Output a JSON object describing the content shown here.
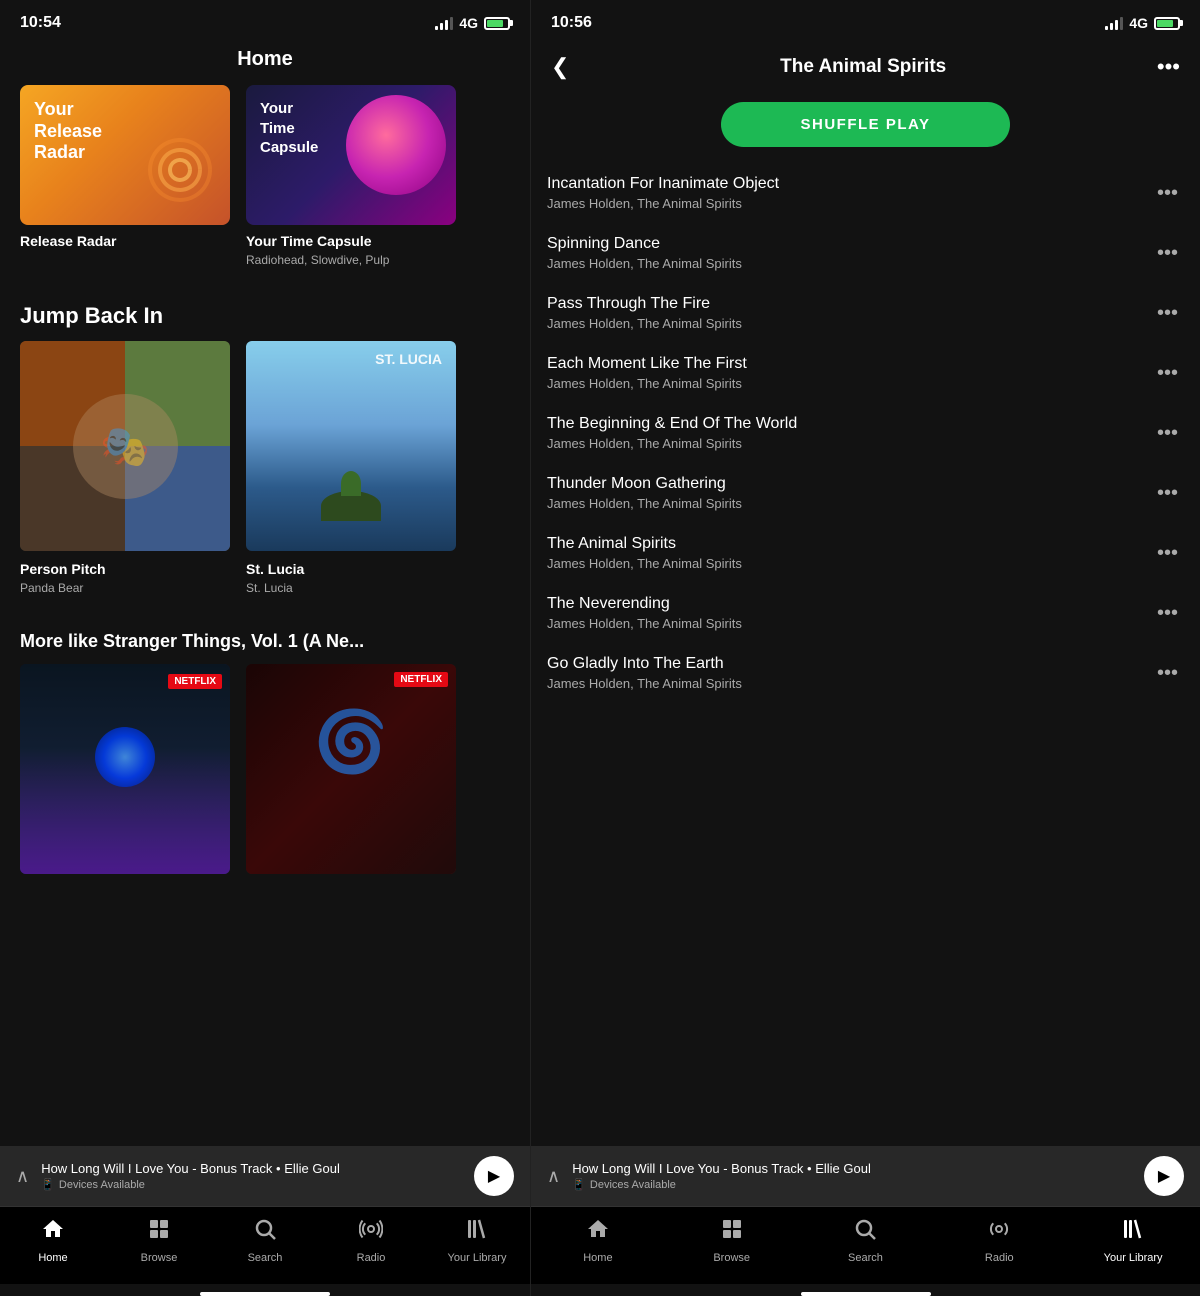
{
  "left": {
    "status": {
      "time": "10:54",
      "signal": "4G",
      "battery": "charging"
    },
    "title": "Home",
    "top_cards": [
      {
        "id": "release-radar",
        "title": "Release Radar",
        "subtitle": ""
      },
      {
        "id": "your-time-capsule",
        "title": "Your Time Capsule",
        "subtitle": "Radiohead, Slowdive, Pulp"
      }
    ],
    "jump_back_title": "Jump Back In",
    "jump_back_albums": [
      {
        "id": "person-pitch",
        "title": "Person Pitch",
        "artist": "Panda Bear"
      },
      {
        "id": "st-lucia",
        "title": "St. Lucia",
        "artist": "St. Lucia"
      }
    ],
    "more_like_title": "More like Stranger Things, Vol. 1 (A Ne...",
    "mini_player": {
      "track": "How Long Will I Love You - Bonus Track • Ellie Goul",
      "device": "Devices Available"
    },
    "nav": {
      "items": [
        {
          "id": "home",
          "label": "Home",
          "icon": "home",
          "active": true
        },
        {
          "id": "browse",
          "label": "Browse",
          "icon": "browse",
          "active": false
        },
        {
          "id": "search",
          "label": "Search",
          "icon": "search",
          "active": false
        },
        {
          "id": "radio",
          "label": "Radio",
          "icon": "radio",
          "active": false
        },
        {
          "id": "library",
          "label": "Your Library",
          "icon": "library",
          "active": false
        }
      ]
    }
  },
  "right": {
    "status": {
      "time": "10:56",
      "signal": "4G",
      "battery": "charging"
    },
    "title": "The Animal Spirits",
    "shuffle_label": "SHUFFLE PLAY",
    "tracks": [
      {
        "name": "Incantation For Inanimate Object",
        "artist": "James Holden, The Animal Spirits"
      },
      {
        "name": "Spinning Dance",
        "artist": "James Holden, The Animal Spirits"
      },
      {
        "name": "Pass Through The Fire",
        "artist": "James Holden, The Animal Spirits"
      },
      {
        "name": "Each Moment Like The First",
        "artist": "James Holden, The Animal Spirits"
      },
      {
        "name": "The Beginning & End Of The World",
        "artist": "James Holden, The Animal Spirits"
      },
      {
        "name": "Thunder Moon Gathering",
        "artist": "James Holden, The Animal Spirits"
      },
      {
        "name": "The Animal Spirits",
        "artist": "James Holden, The Animal Spirits"
      },
      {
        "name": "The Neverending",
        "artist": "James Holden, The Animal Spirits"
      },
      {
        "name": "Go Gladly Into The Earth",
        "artist": "James Holden, The Animal Spirits"
      }
    ],
    "mini_player": {
      "track": "How Long Will I Love You - Bonus Track • Ellie Goul",
      "device": "Devices Available"
    },
    "nav": {
      "items": [
        {
          "id": "home",
          "label": "Home",
          "icon": "home",
          "active": false
        },
        {
          "id": "browse",
          "label": "Browse",
          "icon": "browse",
          "active": false
        },
        {
          "id": "search",
          "label": "Search",
          "icon": "search",
          "active": false
        },
        {
          "id": "radio",
          "label": "Radio",
          "icon": "radio",
          "active": false
        },
        {
          "id": "library",
          "label": "Your Library",
          "icon": "library",
          "active": true
        }
      ]
    }
  }
}
